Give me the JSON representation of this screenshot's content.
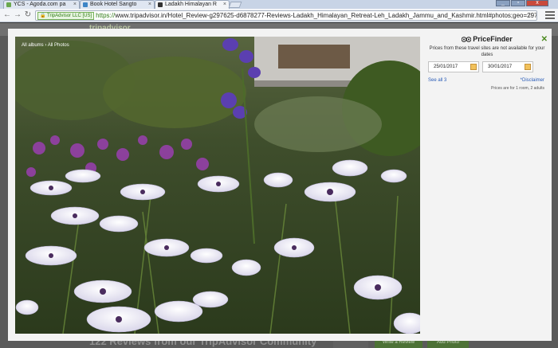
{
  "browser": {
    "tabs": [
      {
        "label": "YCS - Agoda.com pa",
        "favicon_color": "#6aa84f",
        "active": false
      },
      {
        "label": "Book Hotel Sangto",
        "favicon_color": "#3d85c6",
        "active": false
      },
      {
        "label": "Ladakh Himalayan R",
        "favicon_color": "#333333",
        "active": true
      }
    ],
    "site_badge": "TripAdvisor LLC [US]",
    "url_scheme": "https://",
    "url_rest": "www.tripadvisor.in/Hotel_Review-g297625-d6878277-Reviews-Ladakh_Himalayan_Retreat-Leh_Ladakh_Jammu_and_Kashmir.html#photos;geo=297625&de"
  },
  "page": {
    "logo": "tripadvisor",
    "footer_text": "122 Reviews from our TripAdvisor Community",
    "buttons": [
      "",
      "Write a Review",
      "Add Photo"
    ]
  },
  "lightbox": {
    "breadcrumb_all_albums": "All albums",
    "breadcrumb_sep": "›",
    "breadcrumb_current": "All Photos",
    "pricefinder": {
      "brand": "PriceFinder",
      "close": "✕",
      "message": "Prices from these travel sites are not available for your dates",
      "checkin": "25/01/2017",
      "checkout": "30/01/2017",
      "see_all": "See all 3",
      "disclaimer": "*Disclaimer",
      "room_note": "Prices are for 1 room, 2 adults"
    }
  }
}
